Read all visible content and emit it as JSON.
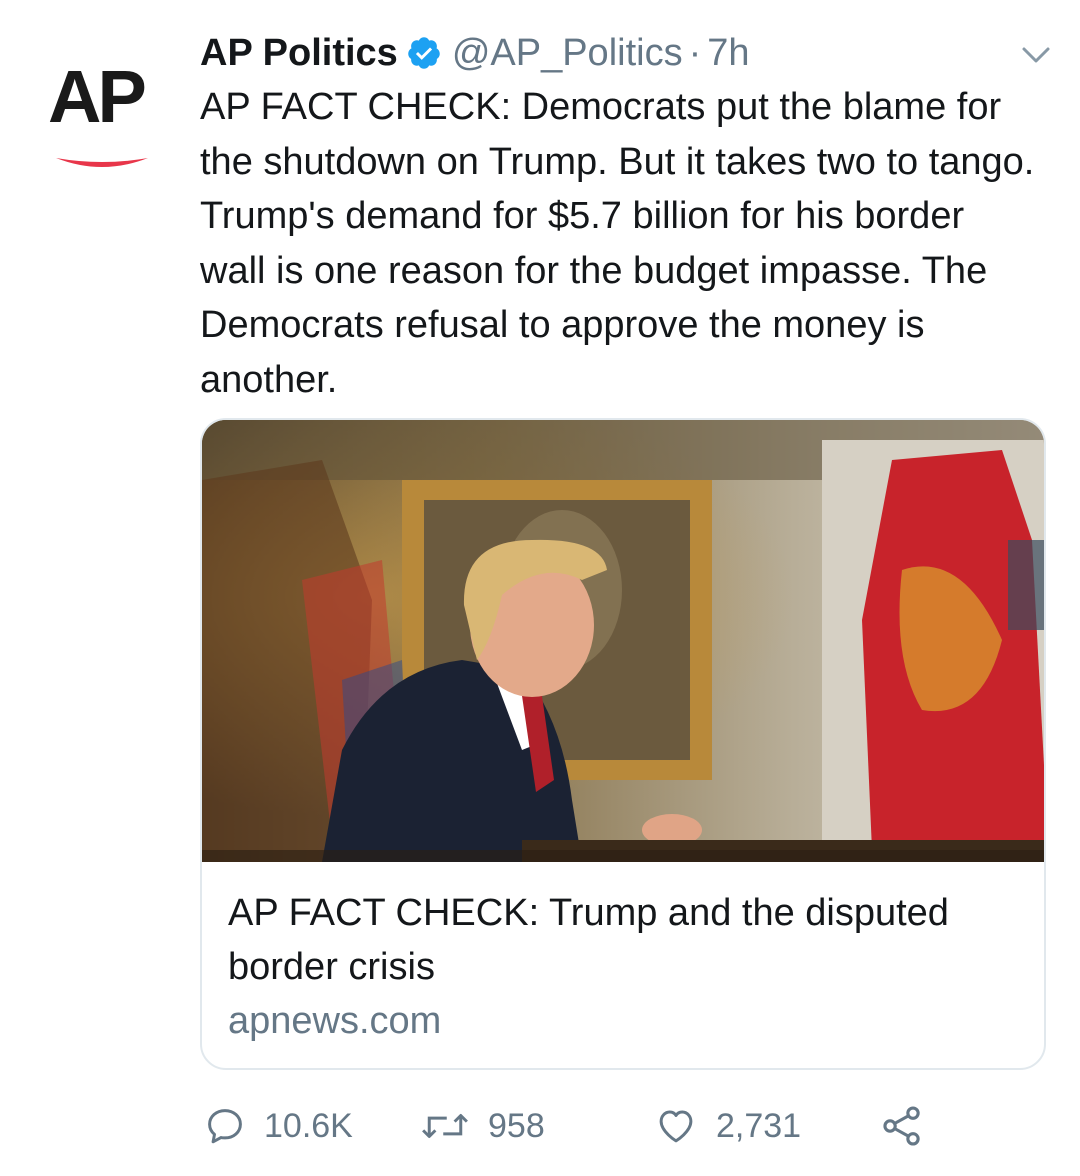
{
  "tweet": {
    "author": {
      "display_name": "AP Politics",
      "handle": "@AP_Politics",
      "separator": "·",
      "time": "7h",
      "avatar_text": "AP",
      "verified": true
    },
    "text": "AP FACT CHECK: Democrats put the blame for the shutdown on Trump. But it takes two to tango. Trump's demand for $5.7 billion for his border wall is one reason for the budget impasse. The Democrats refusal to approve the money is another.",
    "card": {
      "title": "AP FACT CHECK: Trump and the disputed border crisis",
      "domain": "apnews.com"
    },
    "actions": {
      "replies": "10.6K",
      "retweets": "958",
      "likes": "2,731"
    }
  },
  "colors": {
    "text": "#14171a",
    "secondary": "#657786",
    "verified_blue": "#1da1f2",
    "ap_red": "#e8364a",
    "card_border": "#e1e8ed"
  },
  "icons": [
    "verified-badge-icon",
    "chevron-down-icon",
    "reply-icon",
    "retweet-icon",
    "like-icon",
    "share-icon"
  ]
}
